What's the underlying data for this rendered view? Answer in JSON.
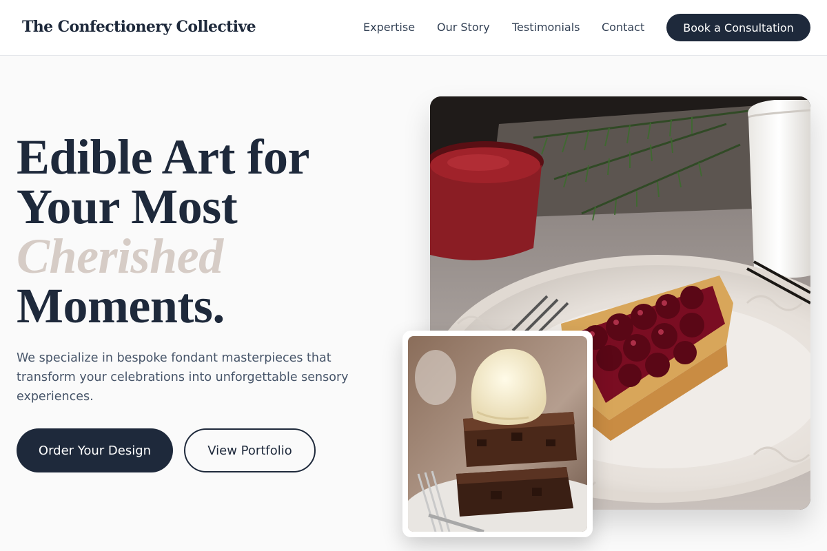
{
  "header": {
    "brand": "The Confectionery Collective",
    "nav": {
      "expertise": "Expertise",
      "story": "Our Story",
      "testimonials": "Testimonials",
      "contact": "Contact"
    },
    "cta": "Book a Consultation"
  },
  "hero": {
    "title_line1": "Edible Art for",
    "title_line2": "Your Most",
    "title_accent": "Cherished",
    "title_line4": "Moments.",
    "subtitle": "We specialize in bespoke fondant masterpieces that transform your celebrations into unforgettable sensory experiences.",
    "primary_button": "Order Your Design",
    "secondary_button": "View Portfolio"
  },
  "images": {
    "main": "cherry-tart-photo",
    "secondary": "brownie-ice-cream-photo"
  },
  "colors": {
    "primary": "#1e293b",
    "accent": "#d6ccc6",
    "background": "#fafafa",
    "body_text": "#475569"
  }
}
